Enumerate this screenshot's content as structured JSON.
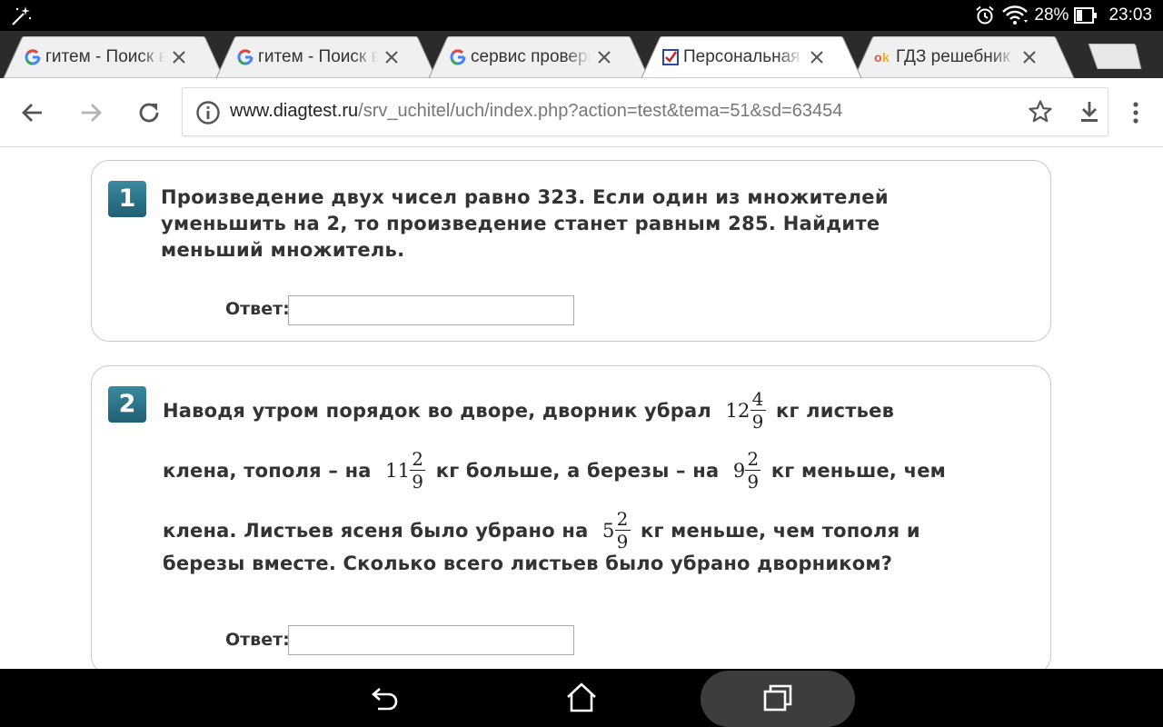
{
  "status_bar": {
    "battery": "28%",
    "time": "23:03",
    "icons": [
      "magic-wand-icon",
      "alarm-icon",
      "wifi-icon",
      "battery-icon"
    ]
  },
  "tabs": [
    {
      "title": "гитем - Поиск в Google",
      "favicon": "google-g-icon",
      "active": false
    },
    {
      "title": "гитем - Поиск в Google",
      "favicon": "google-g-icon",
      "active": false
    },
    {
      "title": "сервис проверки знаний",
      "favicon": "google-g-icon",
      "active": false
    },
    {
      "title": "Персональная страница",
      "favicon": "checkbox-favicon",
      "active": true
    },
    {
      "title": "ГДЗ решебник ранее",
      "favicon": "ok-favicon",
      "active": false
    }
  ],
  "toolbar": {
    "url_host": "www.diagtest.ru",
    "url_path": "/srv_uchitel/uch/index.php?action=test&tema=51&sd=63454"
  },
  "questions": [
    {
      "number": "1",
      "text": "Произведение двух чисел равно 323. Если один из множителей уменьшить на 2, то произведение станет равным 285. Найдите меньший множитель.",
      "answer_label": "Ответ:",
      "answer_value": ""
    },
    {
      "number": "2",
      "lines": [
        {
          "before": "Наводя утром порядок во дворе, дворник убрал",
          "after": "кг листьев"
        },
        {
          "before": "клена, тополя – на",
          "mid": "кг больше, а березы – на",
          "after": "кг меньше, чем"
        },
        {
          "before": "клена. Листьев ясеня было убрано на",
          "after": "кг меньше, чем тополя и"
        },
        {
          "before": "березы вместе. Сколько всего листьев было убрано дворником?"
        }
      ],
      "fractions": {
        "f1": {
          "whole": "12",
          "num": "4",
          "den": "9"
        },
        "f2": {
          "whole": "11",
          "num": "2",
          "den": "9"
        },
        "f3": {
          "whole": "9",
          "num": "2",
          "den": "9"
        },
        "f4": {
          "whole": "5",
          "num": "2",
          "den": "9"
        }
      },
      "answer_label": "Ответ:",
      "answer_value": ""
    }
  ],
  "colors": {
    "qnum_badge": "#2b7186",
    "tab_active": "#ffffff",
    "tab_inactive": "#f0f0f0",
    "tabstrip": "#2b2b2b"
  }
}
